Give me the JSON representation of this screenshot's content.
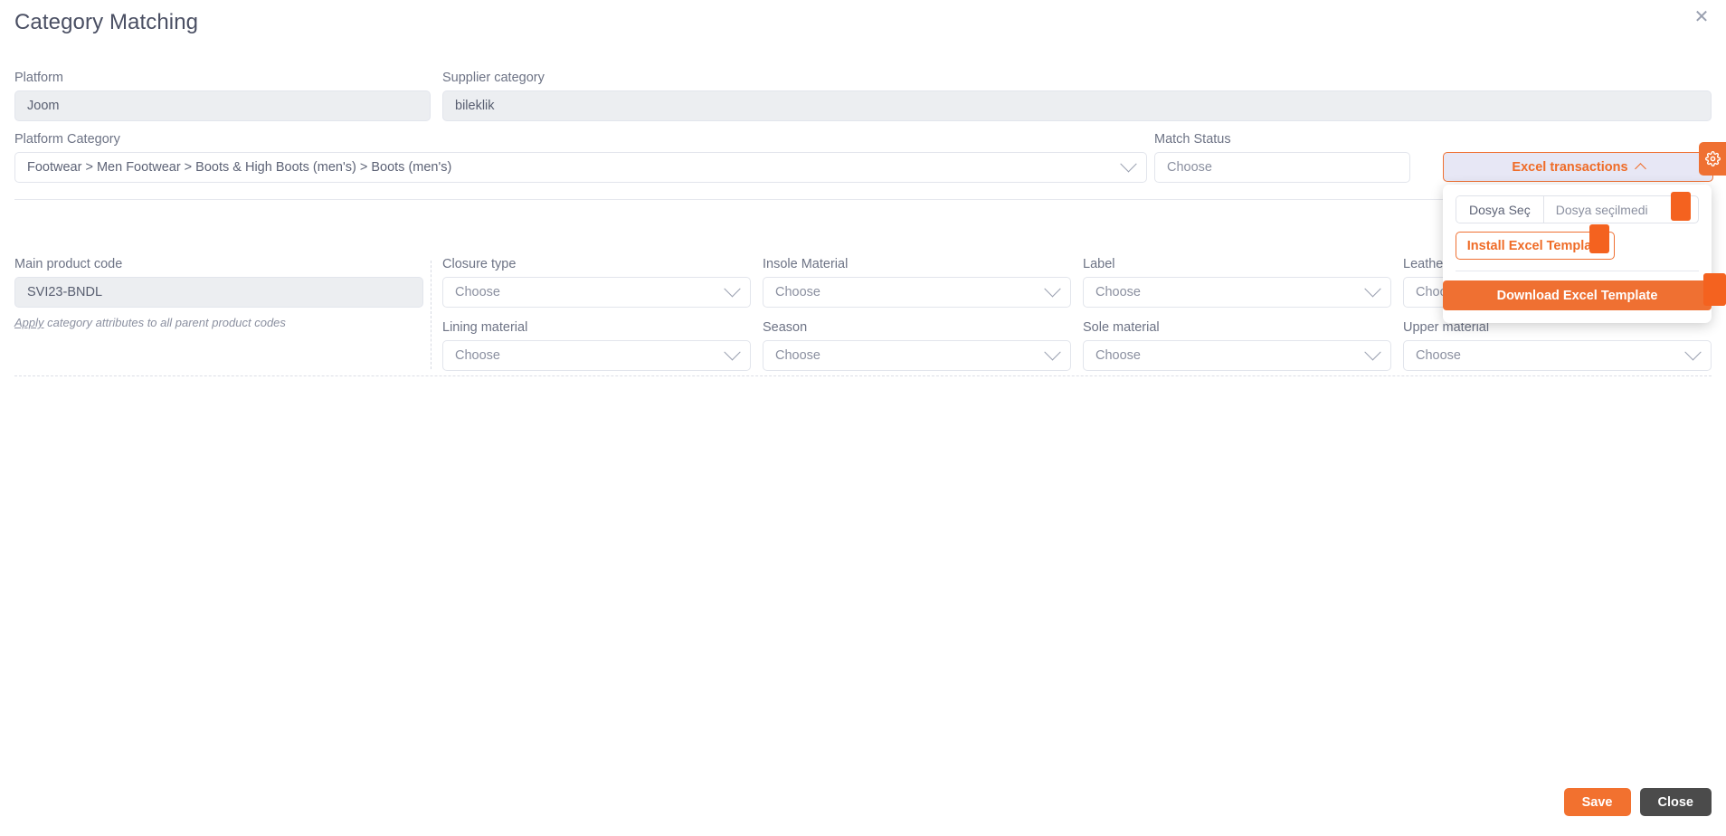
{
  "modal": {
    "title": "Category Matching",
    "close_icon": "close-icon"
  },
  "top": {
    "platform": {
      "label": "Platform",
      "value": "Joom"
    },
    "supplier_category": {
      "label": "Supplier category",
      "value": "bileklik"
    },
    "platform_category": {
      "label": "Platform Category",
      "value": "Footwear > Men Footwear > Boots & High Boots (men's) > Boots (men's)"
    },
    "match_status": {
      "label": "Match Status",
      "placeholder": "Choose"
    }
  },
  "excel": {
    "button_label": "Excel transactions",
    "caret_icon": "chevron-up-icon",
    "file_choose_label": "Dosya Seç",
    "file_status": "Dosya seçilmedi",
    "install_label": "Install Excel Template",
    "download_label": "Download Excel Template"
  },
  "gear": {
    "icon": "gear-icon"
  },
  "product": {
    "main_code_label": "Main product code",
    "main_code_value": "SVI23-BNDL",
    "apply_link": "Apply",
    "apply_rest": " category attributes to all parent product codes"
  },
  "attributes": [
    {
      "label": "Closure type",
      "placeholder": "Choose"
    },
    {
      "label": "Lining material",
      "placeholder": "Choose"
    },
    {
      "label": "Insole Material",
      "placeholder": "Choose"
    },
    {
      "label": "Season",
      "placeholder": "Choose"
    },
    {
      "label": "Label",
      "placeholder": "Choose"
    },
    {
      "label": "Sole material",
      "placeholder": "Choose"
    },
    {
      "label": "Leather",
      "placeholder": "Choose"
    },
    {
      "label": "Upper material",
      "placeholder": "Choose"
    }
  ],
  "footer": {
    "save_label": "Save",
    "close_label": "Close"
  },
  "colors": {
    "accent_orange": "#ef7032",
    "download_orange": "#ef7032",
    "close_gray": "#4b4b4b",
    "label_gray": "#6d7385",
    "field_border": "#e2e5ec",
    "readonly_bg": "#eceef1",
    "excel_btn_bg": "#e7e7f5"
  }
}
